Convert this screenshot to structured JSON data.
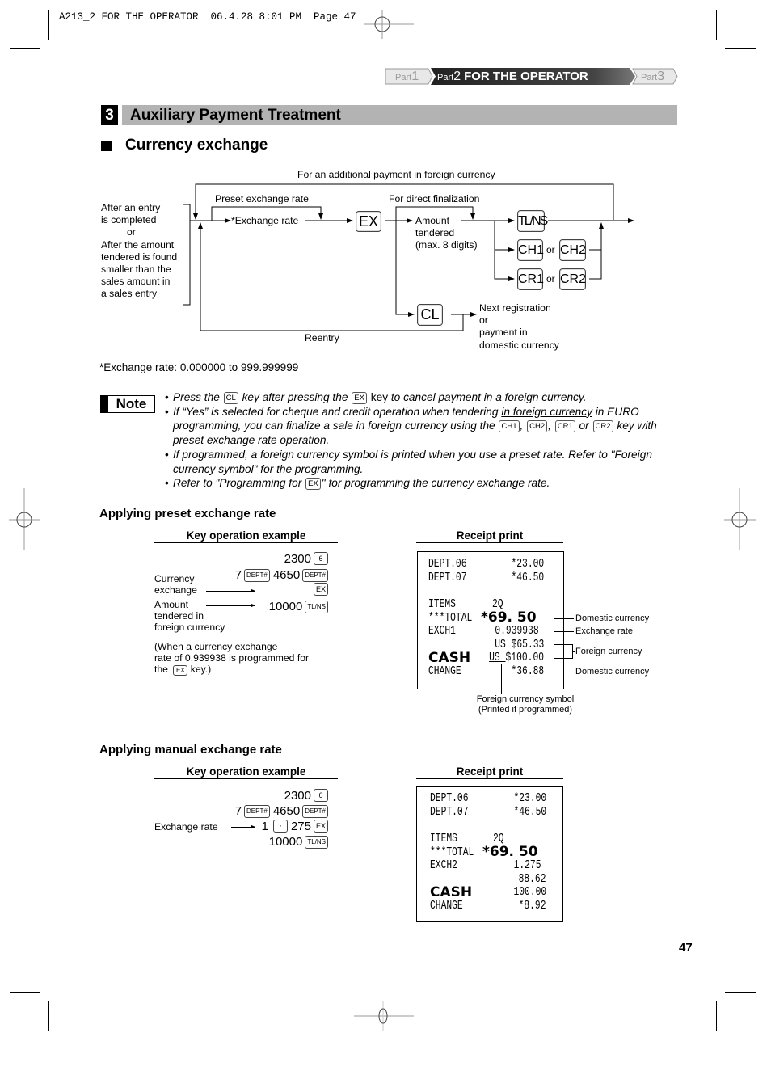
{
  "slug": {
    "text": "A213_2 FOR THE OPERATOR  06.4.28 8:01 PM  Page 47"
  },
  "part_nav": {
    "part1": {
      "prefix": "Part",
      "num": "1"
    },
    "part2": {
      "prefix": "Part",
      "num": "2",
      "title": "FOR THE OPERATOR"
    },
    "part3": {
      "prefix": "Part",
      "num": "3"
    }
  },
  "section": {
    "number": "3",
    "title": "Auxiliary Payment Treatment",
    "subtitle": "Currency exchange"
  },
  "flow": {
    "start_label": [
      "After an entry",
      "is completed",
      "or",
      "After the amount",
      "tendered is found",
      "smaller than the",
      "sales amount in",
      "a sales entry"
    ],
    "additional_payment": "For an additional payment in foreign currency",
    "preset_rate": "Preset exchange rate",
    "exchange_rate": "*Exchange rate",
    "direct_finalization": "For direct finalization",
    "amount_tendered": [
      "Amount",
      "tendered",
      "(max. 8 digits)"
    ],
    "reentry": "Reentry",
    "next_registration": [
      "Next registration",
      "or",
      "payment in",
      "domestic currency"
    ],
    "or": "or",
    "keys": {
      "ex": "EX",
      "tlns": "TL/NS",
      "ch1": "CH1",
      "ch2": "CH2",
      "cr1": "CR1",
      "cr2": "CR2",
      "cl": "CL"
    }
  },
  "rate_note": "*Exchange rate: 0.000000 to 999.999999",
  "note": {
    "badge": "Note",
    "items": [
      {
        "a": "Press the ",
        "k1": "CL",
        "b": " key after pressing the ",
        "k2": "EX",
        "c": " key",
        "d": " to cancel payment in a foreign currency."
      },
      {
        "a": "If “Yes” is selected for cheque and credit operation when tendering ",
        "u": "in foreign currency",
        "b": " in EURO programming, you can finalize a sale in foreign currency using the ",
        "k1": "CH1",
        "k2": "CH2",
        "k3": "CR1",
        "or": " or ",
        "k4": "CR2",
        "c": " key with preset exchange rate operation."
      },
      {
        "a": "If programmed, a foreign currency symbol is printed when you use a preset rate.  Refer to \"Foreign currency symbol\" for the programming."
      },
      {
        "a": "Refer to \"Programming for ",
        "k1": "EX",
        "b": "\" for programming the currency exchange rate."
      }
    ]
  },
  "preset_example": {
    "title": "Applying preset exchange rate",
    "key_header": "Key operation example",
    "receipt_header": "Receipt print",
    "keyops": [
      {
        "pre": "",
        "value": "2300",
        "key": "6"
      },
      {
        "pre": "7",
        "prekey": "DEPT#",
        "value": "4650",
        "key": "DEPT#"
      },
      {
        "pre": "",
        "value": "",
        "key": "EX"
      },
      {
        "pre": "",
        "value": "10000",
        "key": "TL/NS"
      }
    ],
    "labels": {
      "currency_exchange": [
        "Currency",
        "exchange"
      ],
      "amount_tendered": [
        "Amount",
        "tendered in",
        "foreign currency"
      ],
      "footnote": [
        "(When a currency exchange",
        "rate of 0.939938 is programmed for",
        "the "
      ],
      "footnote_key": "EX",
      "footnote_end": " key.)"
    },
    "receipt": {
      "dept06": {
        "label": "DEPT.06",
        "value": "*23.00"
      },
      "dept07": {
        "label": "DEPT.07",
        "value": "*46.50"
      },
      "items": {
        "label": "ITEMS",
        "value": "2Q"
      },
      "total": {
        "label": "***TOTAL",
        "value": "*69. 50"
      },
      "exch": {
        "label": "EXCH1",
        "value": "0.939938"
      },
      "foreign_total": "US $65.33",
      "cash": {
        "label": "CASH",
        "symbol": "US ",
        "value": "$100.00"
      },
      "change": {
        "label": "CHANGE",
        "value": "*36.88"
      }
    },
    "callouts": {
      "domestic1": "Domestic currency",
      "exchange_rate": "Exchange rate",
      "foreign": "Foreign currency",
      "domestic2": "Domestic currency",
      "symbol": [
        "Foreign currency symbol",
        "(Printed if programmed)"
      ]
    }
  },
  "manual_example": {
    "title": "Applying manual exchange rate",
    "key_header": "Key operation example",
    "receipt_header": "Receipt print",
    "label_exchange_rate": "Exchange rate",
    "keyops": [
      {
        "value": "2300",
        "key": "6"
      },
      {
        "pre": "7",
        "prekey": "DEPT#",
        "value": "4650",
        "key": "DEPT#"
      },
      {
        "pre": "1",
        "prekey": "·",
        "value": "275",
        "key": "EX"
      },
      {
        "value": "10000",
        "key": "TL/NS"
      }
    ],
    "receipt": {
      "dept06": {
        "label": "DEPT.06",
        "value": "*23.00"
      },
      "dept07": {
        "label": "DEPT.07",
        "value": "*46.50"
      },
      "items": {
        "label": "ITEMS",
        "value": "2Q"
      },
      "total": {
        "label": "***TOTAL",
        "value": "*69. 50"
      },
      "exch": {
        "label": "EXCH2",
        "value": "1.275"
      },
      "foreign_total": "88.62",
      "cash": {
        "label": "CASH",
        "value": "100.00"
      },
      "change": {
        "label": "CHANGE",
        "value": "*8.92"
      }
    }
  },
  "page_number": "47"
}
